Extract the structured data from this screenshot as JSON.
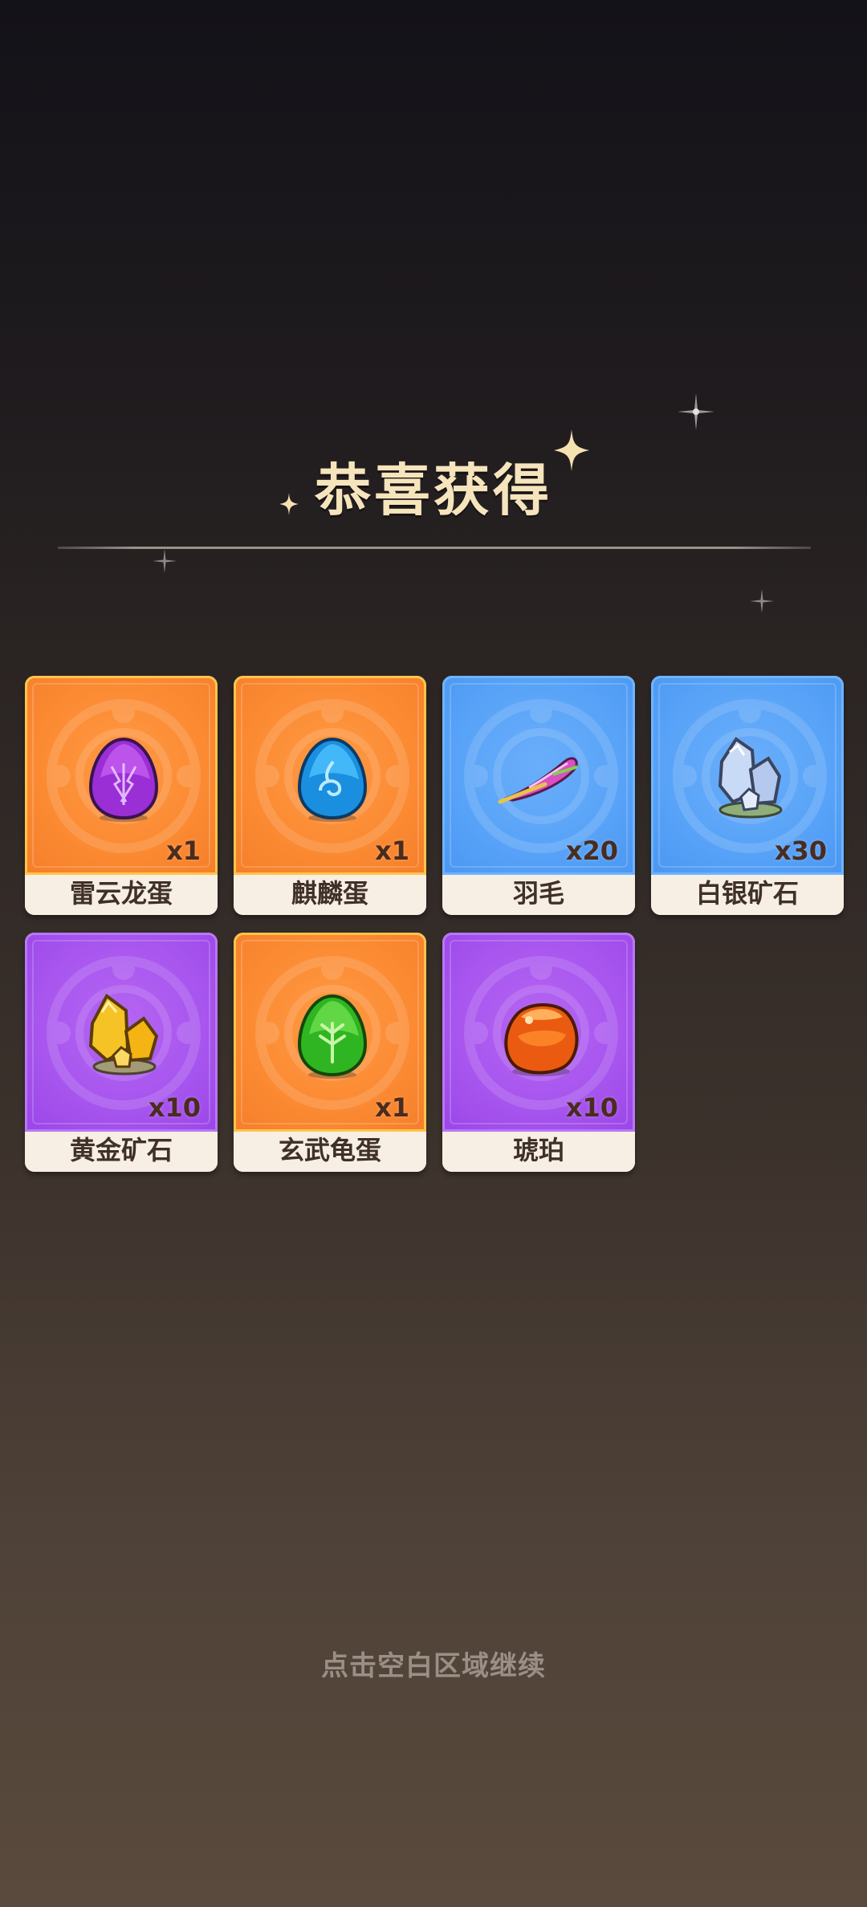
{
  "header": {
    "title": "恭喜获得"
  },
  "items": [
    {
      "name": "雷云龙蛋",
      "count": "x1",
      "rarity": "orange",
      "icon": "purple-thunder-egg-icon"
    },
    {
      "name": "麒麟蛋",
      "count": "x1",
      "rarity": "orange",
      "icon": "blue-water-egg-icon"
    },
    {
      "name": "羽毛",
      "count": "x20",
      "rarity": "blue",
      "icon": "feather-icon"
    },
    {
      "name": "白银矿石",
      "count": "x30",
      "rarity": "blue",
      "icon": "silver-ore-icon"
    },
    {
      "name": "黄金矿石",
      "count": "x10",
      "rarity": "purple",
      "icon": "gold-ore-icon"
    },
    {
      "name": "玄武龟蛋",
      "count": "x1",
      "rarity": "orange",
      "icon": "green-leaf-egg-icon"
    },
    {
      "name": "琥珀",
      "count": "x10",
      "rarity": "purple",
      "icon": "amber-icon"
    }
  ],
  "footer": {
    "hint": "点击空白区域继续"
  },
  "colors": {
    "orange": "#fb8a32",
    "blue": "#58a3f8",
    "purple": "#a755ee",
    "title": "#f6e4bc"
  }
}
